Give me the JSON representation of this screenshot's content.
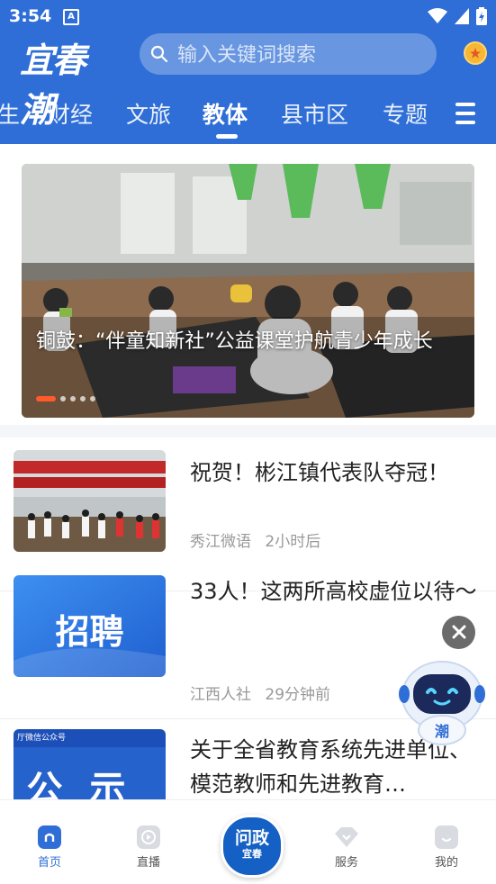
{
  "status_bar": {
    "time": "3:54",
    "notif_glyph": "A"
  },
  "header": {
    "logo_text": "宜春潮",
    "search_placeholder": "输入关键词搜索"
  },
  "tabs": [
    {
      "label": "生",
      "active": false
    },
    {
      "label": "财经",
      "active": false
    },
    {
      "label": "文旅",
      "active": false
    },
    {
      "label": "教体",
      "active": true
    },
    {
      "label": "县市区",
      "active": false
    },
    {
      "label": "专题",
      "active": false
    }
  ],
  "banner": {
    "caption": "铜鼓：“伴童知新社”公益课堂护航青少年成长",
    "slide_count": 5,
    "current_slide": 1
  },
  "news": [
    {
      "title": "祝贺！彬江镇代表队夺冠！",
      "source": "秀江微语",
      "time": "2小时后",
      "thumb_text": ""
    },
    {
      "title": "33人！这两所高校虚位以待～",
      "source": "江西人社",
      "time": "29分钟前",
      "thumb_text": "招聘"
    },
    {
      "title": "关于全省教育系统先进单位、模范教师和先进教育…",
      "source": "",
      "time": "",
      "thumb_text": "公示",
      "thumb_caption": "厅微信公众号"
    }
  ],
  "bottom_nav": [
    {
      "label": "首页",
      "active": true
    },
    {
      "label": "直播",
      "active": false
    },
    {
      "label": "问政宜春",
      "active": false
    },
    {
      "label": "服务",
      "active": false
    },
    {
      "label": "我的",
      "active": false
    }
  ],
  "center_button": {
    "line1": "问政",
    "line2": "宜春"
  },
  "robot_label": "潮",
  "colors": {
    "brand": "#2f6ed6",
    "accent": "#ff5a2a"
  }
}
